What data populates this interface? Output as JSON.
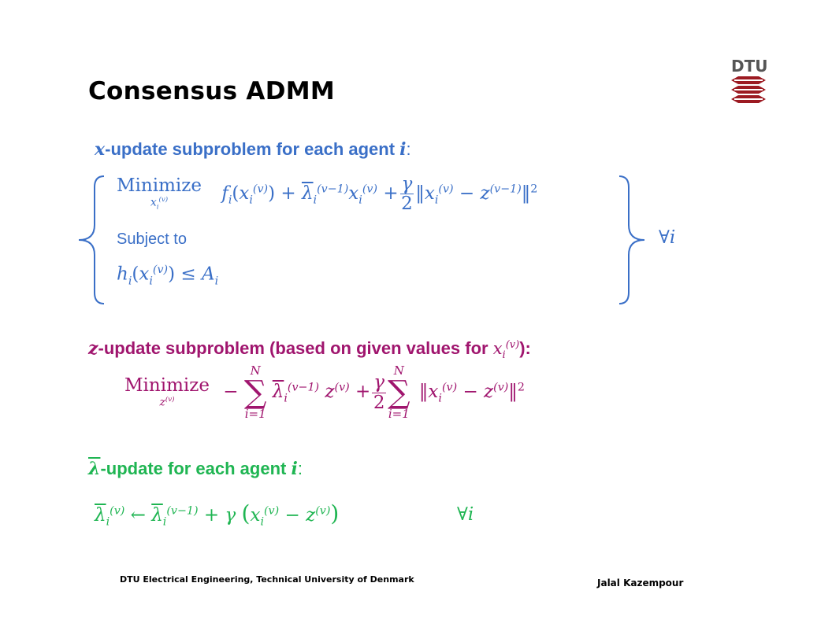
{
  "slide": {
    "title": "Consensus ADMM",
    "logo_text": "DTU",
    "footer_left": "DTU Electrical Engineering, Technical University of Denmark",
    "footer_right": "Jalal Kazempour"
  },
  "x_update": {
    "heading_var": "x",
    "heading_text": "-update subproblem for each agent ",
    "heading_agent": "i",
    "heading_colon": ":",
    "minimize": "Minimize",
    "subject_to": "Subject to",
    "for_all": "∀i"
  },
  "z_update": {
    "heading_var": "z",
    "heading_text": "-update subproblem (based on given values for ",
    "heading_close": "):",
    "minimize": "Minimize",
    "sum_top": "N",
    "sum_bottom": "i=1"
  },
  "lambda_update": {
    "heading_var": "λ",
    "heading_text": "-update for each agent ",
    "heading_agent": "i",
    "heading_colon": ":",
    "for_all": "∀i"
  },
  "colors": {
    "x_update": "#3a6fc7",
    "z_update": "#a0156e",
    "lambda_update": "#1fb552",
    "logo": "#9c1a22"
  }
}
